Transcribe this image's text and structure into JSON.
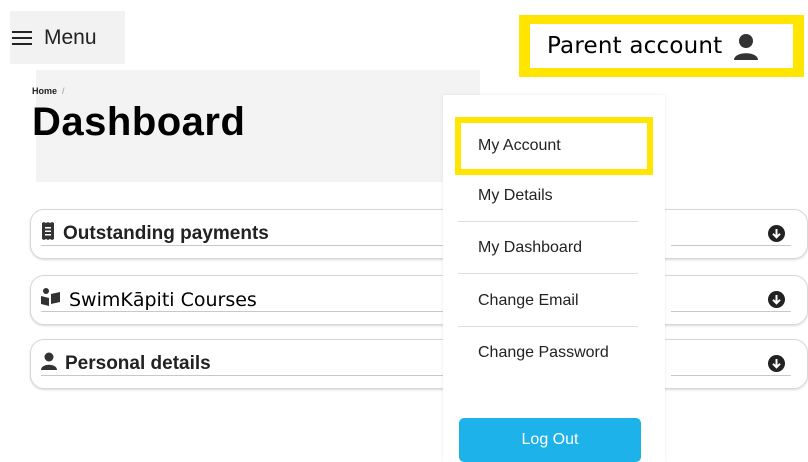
{
  "header": {
    "menu_label": "Menu",
    "account_label": "Parent account"
  },
  "breadcrumb": {
    "home": "Home",
    "separator": "/"
  },
  "page_title": "Dashboard",
  "sections": [
    {
      "label": "Outstanding payments",
      "icon": "receipt-icon"
    },
    {
      "label": "SwimKāpiti Courses",
      "icon": "reader-icon"
    },
    {
      "label": "Personal details",
      "icon": "user-icon"
    }
  ],
  "account_menu": {
    "items": [
      "My Account",
      "My Details",
      "My Dashboard",
      "Change Email",
      "Change Password"
    ],
    "logout_label": "Log Out"
  },
  "colors": {
    "highlight": "#ffe500",
    "logout_button": "#1eb2ea"
  }
}
